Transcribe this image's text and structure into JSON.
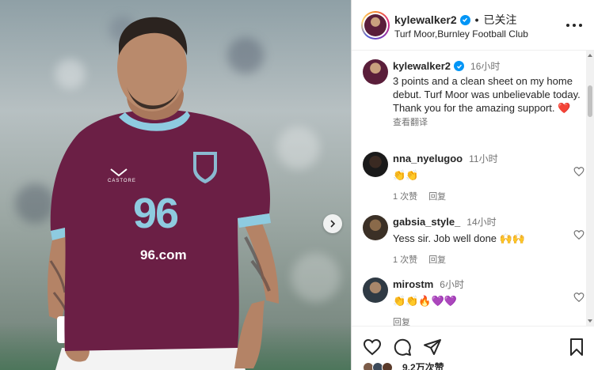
{
  "post": {
    "username": "kylewalker2",
    "follow_status": "已关注",
    "location": "Turf Moor,Burnley Football Club",
    "jersey_number": "96",
    "jersey_sponsor": "96.com",
    "jersey_brand": "CASTORE"
  },
  "caption": {
    "username": "kylewalker2",
    "time": "16小时",
    "text": "3 points and a clean sheet on my home debut. Turf Moor was unbelievable today. Thank you for the amazing support. ❤️",
    "translate_label": "查看翻译"
  },
  "comments": [
    {
      "username": "nna_nyelugoo",
      "time": "11小时",
      "text": "👏👏",
      "likes": "1 次赞",
      "reply": "回复"
    },
    {
      "username": "gabsia_style_",
      "time": "14小时",
      "text": "Yess sir. Job well done 🙌🙌",
      "likes": "1 次赞",
      "reply": "回复"
    },
    {
      "username": "mirostm",
      "time": "6小时",
      "text": "👏👏🔥💜💜",
      "likes": "",
      "reply": "回复"
    }
  ],
  "footer": {
    "likes_count": "9.2万次赞"
  },
  "colors": {
    "verified": "#0095f6",
    "jersey": "#6b1f45",
    "jersey_trim": "#8ecbe0",
    "heart_red": "#ed4956"
  },
  "icons": {
    "header_more": "more-horizontal-icon",
    "like": "heart-outline-icon",
    "comment": "comment-bubble-icon",
    "share": "paper-plane-icon",
    "save": "bookmark-icon",
    "next": "chevron-right-icon"
  }
}
